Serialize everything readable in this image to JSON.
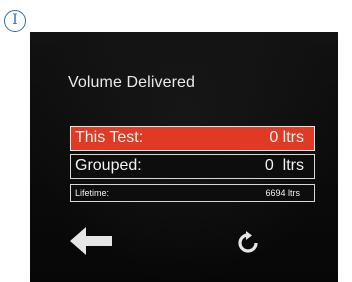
{
  "marker": {
    "symbol": "I",
    "color": "#2d6fb8"
  },
  "screen": {
    "title": "Volume Delivered",
    "rows": [
      {
        "label": "This Test:",
        "value": "0 ltrs",
        "highlight_color": "#e03a24"
      },
      {
        "label": "Grouped:",
        "value": "0  ltrs"
      },
      {
        "label": "Lifetime:",
        "value": "6694 ltrs"
      }
    ],
    "nav": {
      "back_icon": "arrow-left-icon",
      "refresh_icon": "refresh-icon"
    }
  }
}
